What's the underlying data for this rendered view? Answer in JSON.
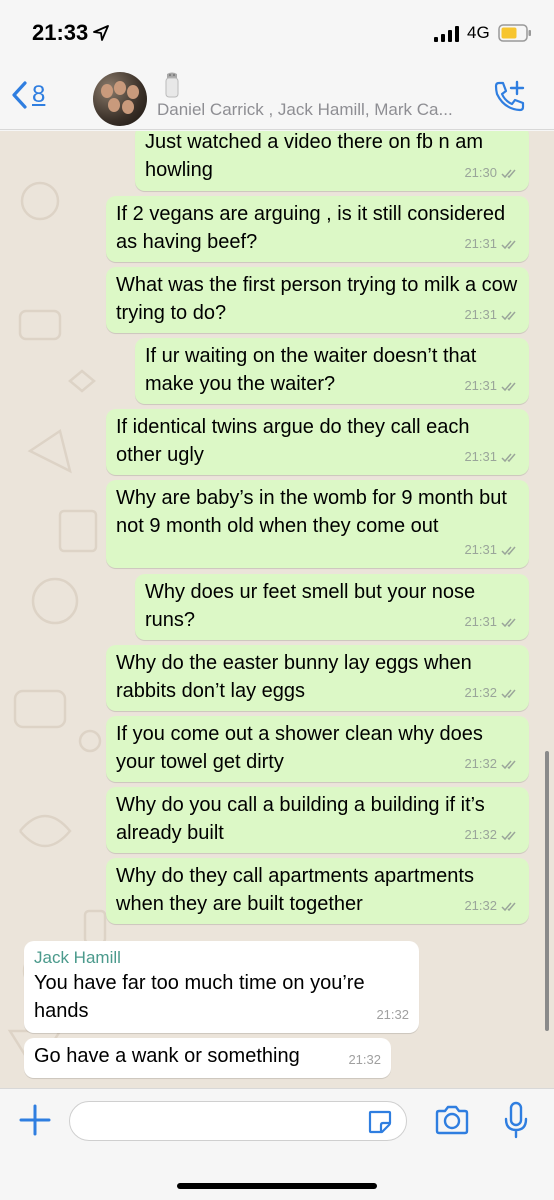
{
  "status_bar": {
    "time": "21:33",
    "network": "4G"
  },
  "header": {
    "back_count": "8",
    "members": "Daniel Carrick , Jack Hamill, Mark Ca...",
    "accent": "#2f7ee0"
  },
  "colors": {
    "outgoing_bubble": "#dcf8c6",
    "incoming_bubble": "#ffffff",
    "chat_bg": "#ebe4da",
    "sender_name": "#4b9a8c"
  },
  "messages": [
    {
      "text": "Just watched a video there on fb n am howling",
      "time": "21:30"
    },
    {
      "text": "If 2 vegans are arguing , is it still considered as having beef?",
      "time": "21:31"
    },
    {
      "text": "What was the first person trying to milk a cow trying to do?",
      "time": "21:31"
    },
    {
      "text": "If ur waiting on the waiter doesn’t that make you the waiter?",
      "time": "21:31"
    },
    {
      "text": "If identical twins argue do they call each other ugly",
      "time": "21:31"
    },
    {
      "text": "Why are baby’s in the womb for 9 month but not 9 month old when they come out",
      "time": "21:31"
    },
    {
      "text": "Why does ur feet smell but your nose runs?",
      "time": "21:31"
    },
    {
      "text": "Why do the easter bunny lay eggs when rabbits don’t lay eggs",
      "time": "21:32"
    },
    {
      "text": "If you come out a shower clean why does your towel get dirty",
      "time": "21:32"
    },
    {
      "text": "Why do you call a building a building if it’s already built",
      "time": "21:32"
    },
    {
      "text": "Why do they call apartments apartments when they are built together",
      "time": "21:32"
    },
    {
      "sender": "Jack Hamill",
      "text": "You have far too much time on you’re hands",
      "time": "21:32"
    },
    {
      "text": "Go have a wank or something",
      "time": "21:32"
    }
  ],
  "input": {
    "value": "",
    "placeholder": ""
  },
  "icons": [
    "location-arrow-icon",
    "signal-icon",
    "battery-icon",
    "back-chevron-icon",
    "salt-shaker-icon",
    "add-call-icon",
    "plus-icon",
    "sticker-icon",
    "camera-icon",
    "microphone-icon",
    "double-check-icon"
  ]
}
